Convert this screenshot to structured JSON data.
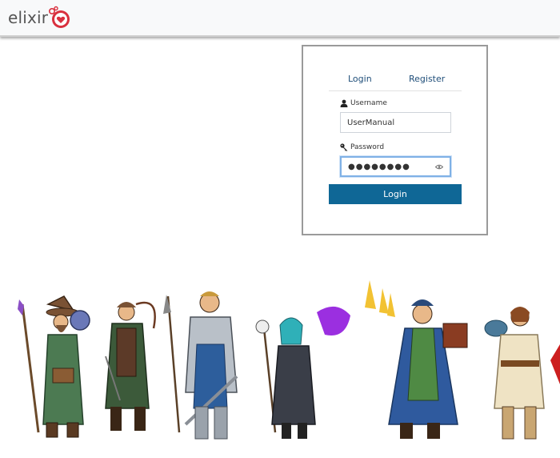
{
  "header": {
    "logo_text": "elixir",
    "brand_color": "#d9303e"
  },
  "auth": {
    "tabs": [
      {
        "label": "Login"
      },
      {
        "label": "Register"
      }
    ],
    "username_label": "Username",
    "username_value": "UserManual",
    "password_label": "Password",
    "password_value": "●●●●●●●●",
    "submit_label": "Login",
    "button_color": "#0f6796",
    "tab_text_color": "#1f4e79"
  },
  "illustration": {
    "characters": [
      "wizard",
      "ranger",
      "knight",
      "necromancer",
      "elf-mage",
      "monk"
    ]
  }
}
